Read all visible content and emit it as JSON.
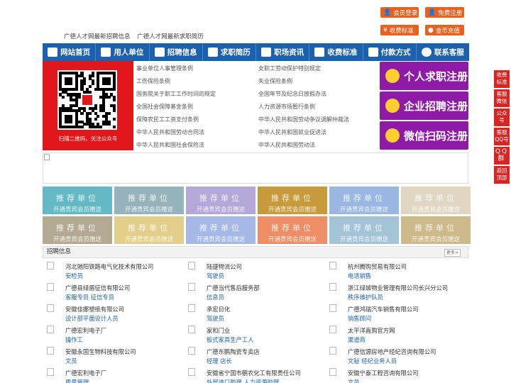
{
  "top_links": [
    "广德人才网最新招聘信息",
    "广德人才网最新求职简历"
  ],
  "top_buttons": [
    {
      "label": "会员登录",
      "icon": "user-icon"
    },
    {
      "label": "免费注册",
      "icon": "user-add-icon"
    },
    {
      "label": "收费标准",
      "icon": "yen-icon"
    },
    {
      "label": "金币充值",
      "icon": "coin-icon"
    }
  ],
  "nav": [
    {
      "label": "网站首页",
      "icon": "home-icon"
    },
    {
      "label": "用人单位",
      "icon": "building-icon"
    },
    {
      "label": "招聘信息",
      "icon": "megaphone-icon"
    },
    {
      "label": "求职简历",
      "icon": "resume-icon"
    },
    {
      "label": "职场资讯",
      "icon": "news-icon"
    },
    {
      "label": "收费标准",
      "icon": "chart-icon"
    },
    {
      "label": "付款方式",
      "icon": "payment-icon"
    },
    {
      "label": "联系客服",
      "icon": "phone-icon"
    }
  ],
  "qr_caption": "扫描二维码，关注公众号",
  "rules_left": [
    "事业单位人事管理条例",
    "工伤保险条例",
    "国务院关于职工工作时间的规定",
    "全国社会保障基金条例",
    "保障农民工工资支付条例",
    "中华人民共和国劳动合同法",
    "中华人民共和国社会保险法"
  ],
  "rules_right": [
    "女职工劳动保护特别规定",
    "失业保险条例",
    "全国年节及纪念日放假办法",
    "人力资源市场暂行条例",
    "中华人民共和国劳动争议调解仲裁法",
    "中华人民共和国就业促进法",
    "中华人民共和国劳动法"
  ],
  "register": [
    {
      "label": "个人求职注册",
      "icon": "person-icon"
    },
    {
      "label": "企业招聘注册",
      "icon": "company-icon"
    },
    {
      "label": "微信扫码注册",
      "icon": "wechat-icon"
    }
  ],
  "tile_text": {
    "title": "推荐单位",
    "sub": "开通贵宾会员赠送"
  },
  "tile_colors": [
    "#65b9c4",
    "#95b3ba",
    "#b3a8d8",
    "#c79a3c",
    "#9ab7e4",
    "#e0d6c2",
    "#b3aa94",
    "#e3cf8a",
    "#a6b8e6",
    "#ee8e66",
    "#a3c3d7",
    "#cdb98a"
  ],
  "jobs_section": {
    "title": "招聘信息",
    "more": "更多>"
  },
  "jobs": [
    [
      {
        "company": "河北驰阳铁路电气化技术有限公司",
        "position": "安检员"
      },
      {
        "company": "陆捷物流公司",
        "position": "驾驶员"
      },
      {
        "company": "杭州腾购贸易有限公司",
        "position": "电话销售"
      }
    ],
    [
      {
        "company": "广德县绿盾征信有限公司",
        "position": "客服专员  征信专员"
      },
      {
        "company": "广德当代售后服务部",
        "position": "信息员"
      },
      {
        "company": "浙江绿城物业管理有限公司长兴分公司",
        "position": "秩序维护队员"
      }
    ],
    [
      {
        "company": "安徽佳娜塑纸有限公司",
        "position": "设计部平面设计人员"
      },
      {
        "company": "承宏日化",
        "position": "驾驶员"
      },
      {
        "company": "广德鸿瑞汽车销售有限公司",
        "position": "销售顾问"
      }
    ],
    [
      {
        "company": "广德宏利电子厂",
        "position": "操作工"
      },
      {
        "company": "家和门业",
        "position": "板式家具生产工人"
      },
      {
        "company": "太平洋直购官方网",
        "position": "渠道商"
      }
    ],
    [
      {
        "company": "安徽永国生物科技有限公司",
        "position": "文员"
      },
      {
        "company": "广德东鹏陶瓷专卖店",
        "position": "经理  店长"
      },
      {
        "company": "广德信源房地产经纪咨询有限公司",
        "position": "文秘  经纪业务人员"
      }
    ],
    [
      {
        "company": "广德宏利电子厂",
        "position": "质量管理"
      },
      {
        "company": "安徽省宁国市朝农化工有限责任公司",
        "position": "外贸进口助理  人力资源助理"
      },
      {
        "company": "安徽宁泰工程咨询有限公司",
        "position": "文员"
      }
    ]
  ],
  "side_buttons": [
    "收费标准",
    "客服微信",
    "公众号",
    "客服QQ号",
    "QQ群",
    "返回顶部"
  ]
}
